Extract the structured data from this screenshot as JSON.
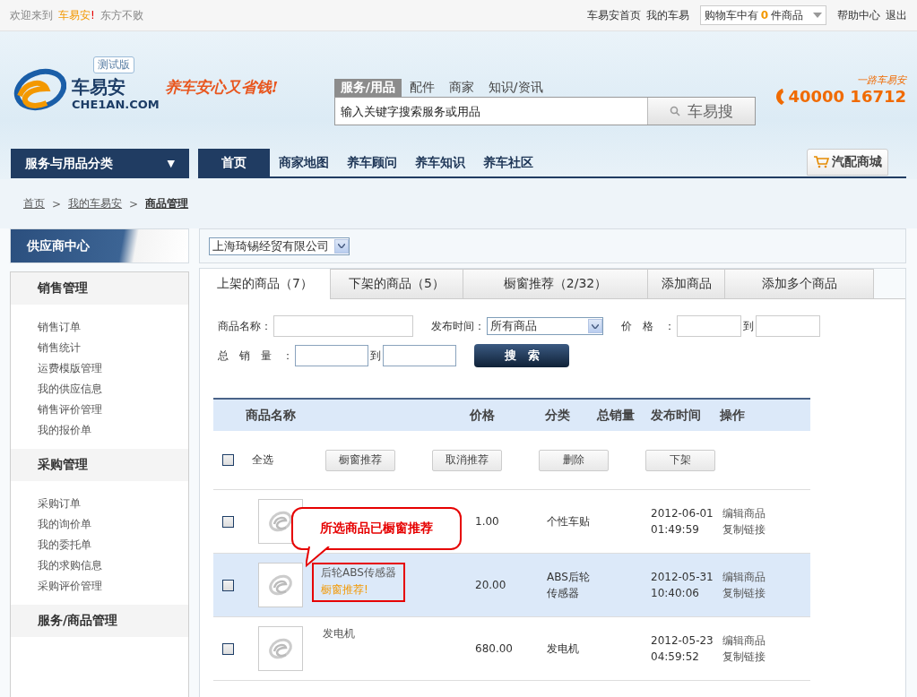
{
  "top_bar": {
    "welcome": "欢迎来到",
    "brand": "车易安",
    "brand_mark": "!",
    "slogan": "东方不败",
    "links": [
      "车易安首页",
      "我的车易"
    ],
    "cart": {
      "prefix": "购物车中有",
      "count": "0",
      "suffix": "件商品"
    },
    "right_links": [
      "帮助中心",
      "退出"
    ]
  },
  "header": {
    "logo_name": "车易安",
    "logo_url": "CHE1AN.COM",
    "badge": "测试版",
    "tagline": "养车安心又省钱!",
    "search_tabs": [
      {
        "label": "服务/用品",
        "selected": true
      },
      {
        "label": "配件",
        "selected": false
      },
      {
        "label": "商家",
        "selected": false
      },
      {
        "label": "知识/资讯",
        "selected": false
      }
    ],
    "search_placeholder": "输入关键字搜索服务或用品",
    "search_button": "车易搜",
    "hotline_caption": "一路车易安",
    "hotline": "40000 16712"
  },
  "nav": {
    "category": "服务与用品分类",
    "category_caret": "▼",
    "items": [
      {
        "label": "首页",
        "selected": true
      },
      {
        "label": "商家地图",
        "selected": false
      },
      {
        "label": "养车顾问",
        "selected": false
      },
      {
        "label": "养车知识",
        "selected": false
      },
      {
        "label": "养车社区",
        "selected": false
      }
    ],
    "mall": "汽配商城"
  },
  "breadcrumb": [
    {
      "label": "首页",
      "current": false
    },
    {
      "label": "我的车易安",
      "current": false
    },
    {
      "label": "商品管理",
      "current": true
    }
  ],
  "breadcrumb_separator": ">",
  "sidebar": {
    "title": "供应商中心",
    "sections": [
      {
        "heading": "销售管理",
        "items": [
          "销售订单",
          "销售统计",
          "运费模版管理",
          "我的供应信息",
          "销售评价管理",
          "我的报价单"
        ]
      },
      {
        "heading": "采购管理",
        "items": [
          "采购订单",
          "我的询价单",
          "我的委托单",
          "我的求购信息",
          "采购评价管理"
        ]
      },
      {
        "heading": "服务/商品管理"
      }
    ]
  },
  "company_select": "上海琦锡经贸有限公司",
  "tabs": [
    {
      "label": "上架的商品（7）",
      "selected": true
    },
    {
      "label": "下架的商品（5）",
      "selected": false
    },
    {
      "label": "橱窗推荐（2/32）",
      "selected": false
    },
    {
      "label": "添加商品",
      "selected": false
    },
    {
      "label": "添加多个商品",
      "selected": false
    }
  ],
  "filters": {
    "name_label": "商品名称：",
    "time_label": "发布时间：",
    "time_value": "所有商品",
    "price_label": "价　格　：",
    "to": "到",
    "sales_label": "总　销　量　：",
    "sales_to": "到",
    "search_button": "搜　索"
  },
  "table": {
    "columns": [
      "商品名称",
      "价格",
      "分类",
      "总销量",
      "发布时间",
      "操作"
    ],
    "select_all": {
      "label": "全选",
      "checked": false
    },
    "actions": [
      "橱窗推荐",
      "取消推荐",
      "删除",
      "下架"
    ],
    "rows": [
      {
        "price": "1.00",
        "category": "个性车贴",
        "date": "2012-06-01",
        "time": "01:49:59",
        "ops": [
          "编辑商品",
          "复制链接"
        ],
        "checked": false,
        "highlighted": false
      },
      {
        "name": "后轮ABS传感器",
        "recommended": "橱窗推荐!",
        "callout": "所选商品已橱窗推荐",
        "price": "20.00",
        "category": "ABS后轮传感器",
        "date": "2012-05-31",
        "time": "10:40:06",
        "ops": [
          "编辑商品",
          "复制链接"
        ],
        "checked": false,
        "highlighted": true
      },
      {
        "name": "发电机",
        "price": "680.00",
        "category": "发电机",
        "date": "2012-05-23",
        "time": "04:59:52",
        "ops": [
          "编辑商品",
          "复制链接"
        ],
        "checked": false,
        "highlighted": false
      }
    ]
  }
}
